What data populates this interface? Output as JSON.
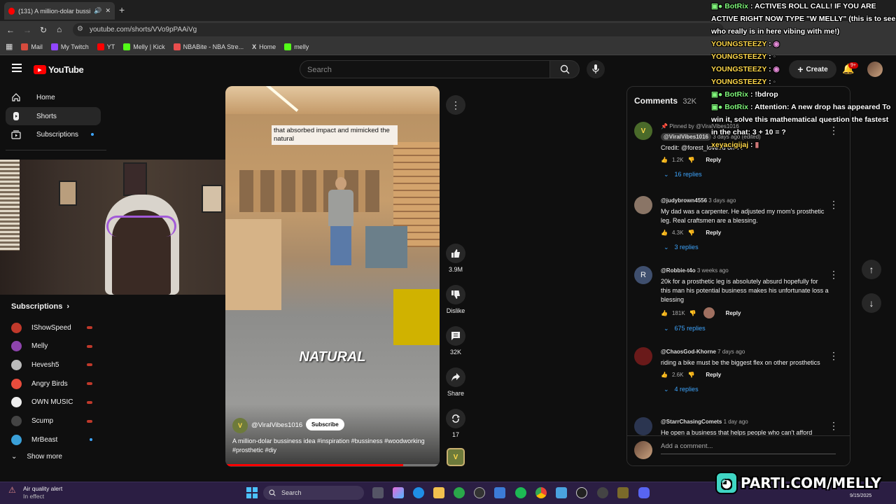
{
  "browser": {
    "tab_title": "(131) A million-dolar bussi",
    "url": "youtube.com/shorts/VVo9pPAAiVg",
    "bookmarks": [
      {
        "label": "Mail",
        "color": "#d54b3d"
      },
      {
        "label": "My Twitch",
        "color": "#9146ff"
      },
      {
        "label": "YT",
        "color": "#ff0000"
      },
      {
        "label": "Melly | Kick",
        "color": "#53fc18"
      },
      {
        "label": "NBABite - NBA Stre...",
        "color": "#e94e4e"
      },
      {
        "label": "Home",
        "color": "#ffffff"
      },
      {
        "label": "melly",
        "color": "#53fc18"
      }
    ]
  },
  "youtube": {
    "logo_text": "YouTube",
    "search_placeholder": "Search",
    "create_label": "Create",
    "notif_badge": "9+"
  },
  "sidebar": {
    "nav": [
      {
        "label": "Home",
        "icon": "home-icon"
      },
      {
        "label": "Shorts",
        "icon": "shorts-icon"
      },
      {
        "label": "Subscriptions",
        "icon": "subscriptions-icon"
      }
    ],
    "subscriptions_header": "Subscriptions",
    "subs": [
      {
        "name": "IShowSpeed",
        "color": "#c0392b",
        "live": true
      },
      {
        "name": "Melly",
        "color": "#8e44ad",
        "live": true
      },
      {
        "name": "Hevesh5",
        "color": "#bbbbbb",
        "live": true
      },
      {
        "name": "Angry Birds",
        "color": "#e74c3c",
        "live": true
      },
      {
        "name": "OWN MUSIC",
        "color": "#eeeeee",
        "live": true
      },
      {
        "name": "Scump",
        "color": "#444444",
        "live": true
      },
      {
        "name": "MrBeast",
        "color": "#3aa0d8",
        "live": false
      }
    ],
    "show_more": "Show more"
  },
  "video": {
    "caption_top": "that absorbed impact and mimicked the natural",
    "caption_big": "NATURAL",
    "channel": "@ViralVibes1016",
    "subscribe_label": "Subscribe",
    "description": "A million-dolar bussiness idea #inspiration #bussiness #woodworking #prosthetic #diy",
    "progress": 0.83
  },
  "actions": {
    "likes": "3.9M",
    "dislike": "Dislike",
    "comments": "32K",
    "share": "Share",
    "remix": "17"
  },
  "comments": {
    "title": "Comments",
    "count": "32K",
    "add_placeholder": "Add a comment...",
    "items": [
      {
        "pinned": "Pinned by @ViralVibes1016",
        "user": "@ViralVibes1016",
        "time": "3 days ago (edited)",
        "text": "Credit: @forest_love.ru on TT",
        "likes": "1.2K",
        "replies": "16 replies",
        "color": "#4a6a2a"
      },
      {
        "user": "@judybrown4556",
        "time": "3 days ago",
        "text": "My dad was a carpenter. He adjusted my mom's prosthetic leg. Real craftsmen are a blessing.",
        "likes": "4.3K",
        "replies": "3 replies",
        "color": "#8a7566"
      },
      {
        "user": "@Robbie-t4o",
        "time": "3 weeks ago",
        "text": "20k for a prosthetic leg is absolutely absurd hopefully for this man his potential business makes his unfortunate loss a blessing",
        "likes": "181K",
        "replies": "675 replies",
        "color": "#3f4f6e",
        "initial": "R"
      },
      {
        "user": "@ChaosGod-Khorne",
        "time": "7 days ago",
        "text": "riding a bike must be the biggest flex on other prosthetics",
        "likes": "2.6K",
        "replies": "4 replies",
        "color": "#6a1a1a"
      },
      {
        "user": "@StarrChasingComets",
        "time": "1 day ago",
        "text": "He open a business that helps people who can't afford",
        "color": "#2b3550"
      }
    ],
    "reply_label": "Reply"
  },
  "chat": [
    {
      "name": "BotRix",
      "type": "bot",
      "text": ": ACTIVES ROLL CALL! IF YOU ARE ACTIVE RIGHT NOW TYPE \"W MELLY\" (this is to see who really is in here vibing with me!)"
    },
    {
      "name": "YOUNGSTEEZY",
      "type": "user",
      "text": ":"
    },
    {
      "name": "YOUNGSTEEZY",
      "type": "user",
      "text": ":"
    },
    {
      "name": "YOUNGSTEEZY",
      "type": "user",
      "text": ":"
    },
    {
      "name": "YOUNGSTEEZY",
      "type": "user",
      "text": ":"
    },
    {
      "name": "BotRix",
      "type": "bot",
      "text": ": !bdrop"
    },
    {
      "name": "BotRix",
      "type": "bot",
      "text": ": Attention: A new drop has appeared To win it, solve this mathematical question the fastest in the chat: 3 + 10 = ?"
    },
    {
      "name": "xeyacigijaj",
      "type": "user",
      "text": ":"
    }
  ],
  "taskbar": {
    "weather_title": "Air quality alert",
    "weather_sub": "In effect",
    "search": "Search",
    "date": "9/15/2025"
  },
  "overlay_logo": "PARTI.COM/MELLY",
  "colors": {
    "accent_red": "#ff0000",
    "link_blue": "#3ea6ff",
    "bot_green": "#7ff57a",
    "user_yellow": "#ffd84a"
  }
}
